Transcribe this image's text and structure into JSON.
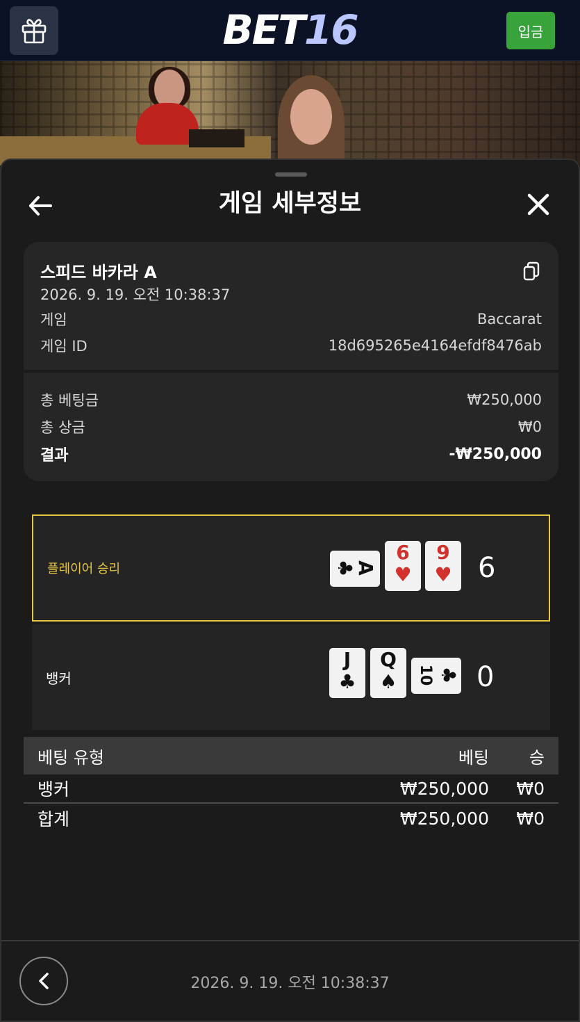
{
  "topbar": {
    "logo_part1": "BET",
    "logo_part2": "16",
    "deposit_label": "입금",
    "gift_icon": "gift-icon"
  },
  "sheet": {
    "title": "게임 세부정보",
    "back_icon": "arrow-left-icon",
    "close_icon": "close-icon"
  },
  "info": {
    "game_name": "스피드 바카라 A",
    "datetime": "2026. 9. 19. 오전 10:38:37",
    "game_label": "게임",
    "game_value": "Baccarat",
    "game_id_label": "게임 ID",
    "game_id_value": "18d695265e4164efdf8476ab",
    "copy_icon": "copy-icon"
  },
  "totals": {
    "total_bet_label": "총 베팅금",
    "total_bet_value": "₩250,000",
    "total_prize_label": "총 상금",
    "total_prize_value": "₩0",
    "result_label": "결과",
    "result_value": "-₩250,000"
  },
  "hands": {
    "player": {
      "label": "플레이어 승리",
      "score": "6",
      "cards": [
        {
          "rank": "A",
          "suit": "♣",
          "orientation": "sideways"
        },
        {
          "rank": "6",
          "suit": "♥",
          "orientation": "upright"
        },
        {
          "rank": "9",
          "suit": "♥",
          "orientation": "upright"
        }
      ]
    },
    "banker": {
      "label": "뱅커",
      "score": "0",
      "cards": [
        {
          "rank": "J",
          "suit": "♣",
          "orientation": "upright"
        },
        {
          "rank": "Q",
          "suit": "♠",
          "orientation": "upright"
        },
        {
          "rank": "10",
          "suit": "♣",
          "orientation": "sideways"
        }
      ]
    }
  },
  "bets_table": {
    "headers": [
      "베팅 유형",
      "베팅",
      "승"
    ],
    "rows": [
      {
        "type": "뱅커",
        "bet": "₩250,000",
        "win": "₩0"
      },
      {
        "type": "합계",
        "bet": "₩250,000",
        "win": "₩0"
      }
    ]
  },
  "footer": {
    "datetime": "2026. 9. 19. 오전 10:38:37",
    "prev_icon": "chevron-left-icon"
  },
  "colors": {
    "accent_gold": "#e8c640",
    "deposit_green": "#38a23b",
    "card_red": "#d2312c",
    "topbar_navy": "#0b1226"
  }
}
